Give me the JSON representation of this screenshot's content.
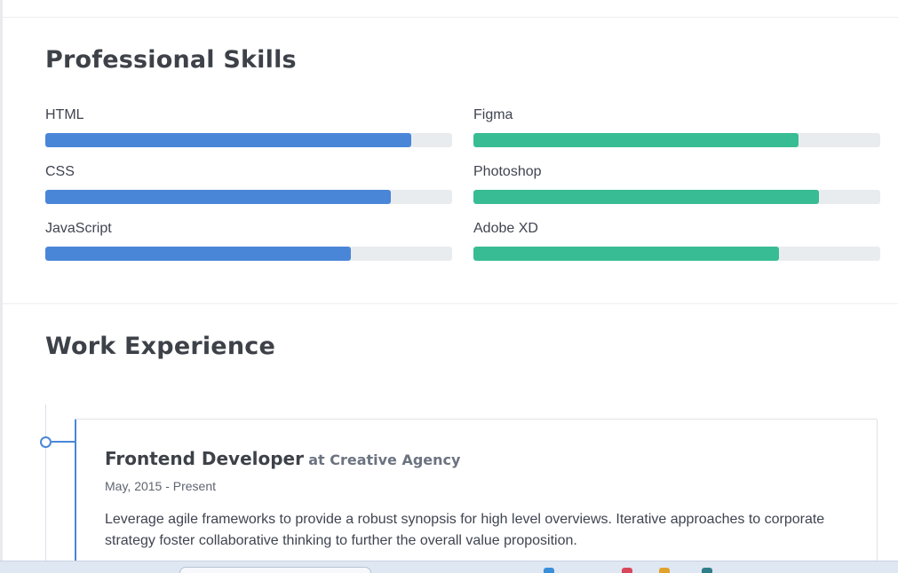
{
  "skills": {
    "title": "Professional Skills",
    "left_color": "#4a86d8",
    "right_color": "#38bc94",
    "items": [
      {
        "label": "HTML",
        "level": 0.9,
        "column": "left"
      },
      {
        "label": "Figma",
        "level": 0.8,
        "column": "right"
      },
      {
        "label": "CSS",
        "level": 0.85,
        "column": "left"
      },
      {
        "label": "Photoshop",
        "level": 0.85,
        "column": "right"
      },
      {
        "label": "JavaScript",
        "level": 0.75,
        "column": "left"
      },
      {
        "label": "Adobe XD",
        "level": 0.75,
        "column": "right"
      }
    ]
  },
  "experience": {
    "title": "Work Experience",
    "jobs": [
      {
        "role": "Frontend Developer",
        "company": "at Creative Agency",
        "dates": "May, 2015 - Present",
        "description": "Leverage agile frameworks to provide a robust synopsis for high level overviews. Iterative approaches to corporate strategy foster collaborative thinking to further the overall value proposition."
      }
    ]
  },
  "colors": {
    "accent": "#4a86d8",
    "secondary": "#38bc94",
    "track": "#e9ecef"
  }
}
